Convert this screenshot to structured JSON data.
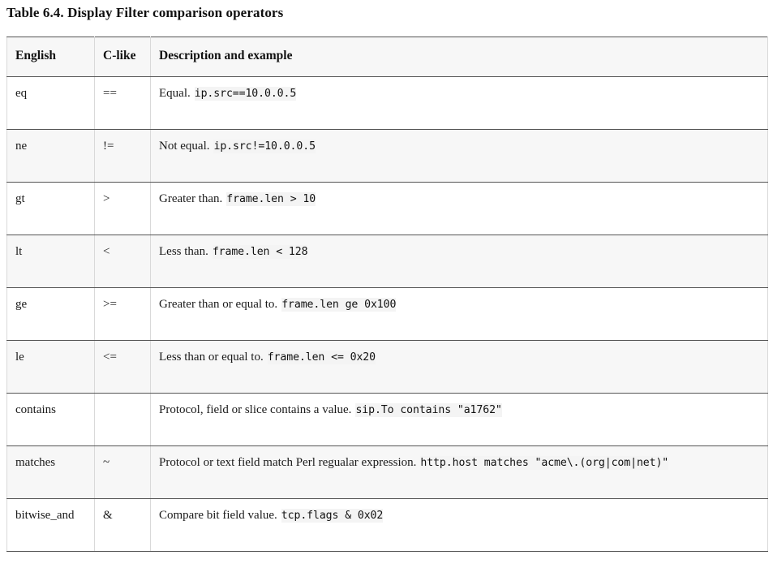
{
  "table": {
    "title": "Table 6.4. Display Filter comparison operators",
    "columns": [
      "English",
      "C-like",
      "Description and example"
    ],
    "rows": [
      {
        "english": "eq",
        "clike": "==",
        "description": "Equal.",
        "example": "ip.src==10.0.0.5"
      },
      {
        "english": "ne",
        "clike": "!=",
        "description": "Not equal.",
        "example": "ip.src!=10.0.0.5"
      },
      {
        "english": "gt",
        "clike": ">",
        "description": "Greater than.",
        "example": "frame.len > 10"
      },
      {
        "english": "lt",
        "clike": "<",
        "description": "Less than.",
        "example": "frame.len < 128"
      },
      {
        "english": "ge",
        "clike": ">=",
        "description": "Greater than or equal to.",
        "example": "frame.len ge 0x100"
      },
      {
        "english": "le",
        "clike": "<=",
        "description": "Less than or equal to.",
        "example": "frame.len <= 0x20"
      },
      {
        "english": "contains",
        "clike": "",
        "description": "Protocol, field or slice contains a value.",
        "example": "sip.To contains \"a1762\""
      },
      {
        "english": "matches",
        "clike": "~",
        "description": "Protocol or text field match Perl regualar expression.",
        "example": "http.host matches \"acme\\.(org|com|net)\""
      },
      {
        "english": "bitwise_and",
        "clike": "&",
        "description": "Compare bit field value.",
        "example": "tcp.flags & 0x02"
      }
    ]
  },
  "colors": {
    "page_background": "#ffffff",
    "row_shade": "#f7f7f7",
    "row_plain": "#ffffff",
    "rule": "#555555",
    "vertical_rule": "#d9d9d9",
    "code_background": "#f4f4f4",
    "text": "#1a1a1a"
  }
}
